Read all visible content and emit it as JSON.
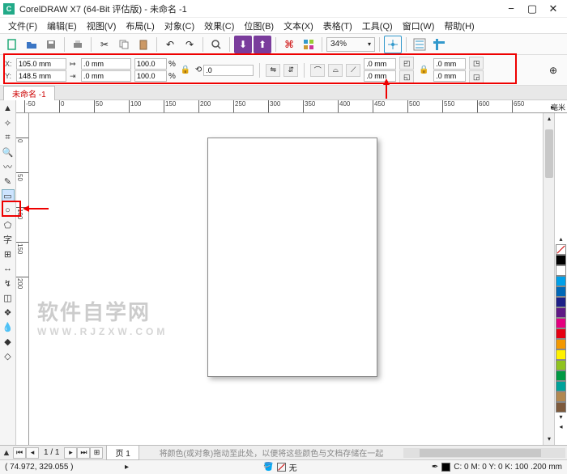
{
  "title": "CorelDRAW X7 (64-Bit 评估版) - 未命名 -1",
  "menu": [
    "文件(F)",
    "编辑(E)",
    "视图(V)",
    "布局(L)",
    "对象(C)",
    "效果(C)",
    "位图(B)",
    "文本(X)",
    "表格(T)",
    "工具(Q)",
    "窗口(W)",
    "帮助(H)"
  ],
  "zoom": "34%",
  "prop": {
    "x_label": "X:",
    "y_label": "Y:",
    "x": "105.0 mm",
    "y": "148.5 mm",
    "w": ".0 mm",
    "h": ".0 mm",
    "sx": "100.0",
    "sy": "100.0",
    "pct": "%",
    "rot": ".0",
    "corner1a": ".0 mm",
    "corner1b": ".0 mm",
    "corner2a": ".0 mm",
    "corner2b": ".0 mm"
  },
  "doctab": "未命名 -1",
  "ruler_unit": "毫米",
  "hruler": [
    "-50",
    "0",
    "50",
    "100",
    "150",
    "200",
    "250",
    "300",
    "350",
    "400",
    "450",
    "500",
    "550",
    "600",
    "650"
  ],
  "vruler": [
    "0",
    "50",
    "100",
    "150",
    "200"
  ],
  "watermark_main": "软件自学网",
  "watermark_sub": "WWW.RJZXW.COM",
  "pagenav": {
    "pos": "1 / 1",
    "tab": "页 1",
    "hint": "将颜色(或对象)拖动至此处，以便将这些颜色与文档存储在一起"
  },
  "status": {
    "coords": "( 74.972, 329.055 )",
    "fill_none": "无",
    "outline": "C: 0 M: 0 Y: 0 K: 100  .200 mm"
  },
  "palette": [
    "#ffffff",
    "#000000",
    "#00a0e9",
    "#e60012",
    "#f39800",
    "#fff100",
    "#8fc31f",
    "#009944",
    "#00a29a",
    "#0068b7",
    "#1d2088",
    "#601986",
    "#920783",
    "#e4007f",
    "#e5004f",
    "#b28850",
    "#7d5a3c"
  ],
  "arrow_glyph": "▸"
}
